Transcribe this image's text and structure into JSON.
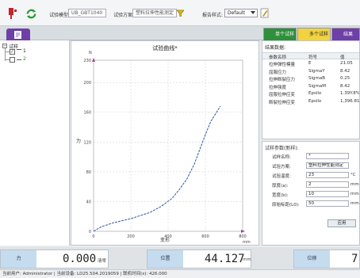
{
  "toolbar": {
    "model_label": "试验模型:",
    "model_value": "UB_GBT1040",
    "scheme_label": "试验方案:",
    "scheme_value": "塑料拉伸性能测定",
    "report_label": "报告样式:",
    "report_value": "Default"
  },
  "tabs": {
    "left_icon": "doc-icon",
    "right": [
      "单个试样",
      "多个试样",
      "结果"
    ]
  },
  "tree": {
    "root": "试样",
    "items": [
      "1",
      "2"
    ]
  },
  "chart_data": {
    "type": "line",
    "title": "试验曲线*",
    "xlabel": "变形",
    "ylabel": "力",
    "y_unit": "N",
    "x_unit": "mm",
    "xlim": [
      0,
      800
    ],
    "ylim": [
      0,
      230
    ],
    "x_ticks": [
      "0",
      "200",
      "400",
      "600",
      "800"
    ],
    "y_ticks": [
      "0",
      "40",
      "80",
      "120",
      "160",
      "200",
      "230"
    ],
    "series": [
      {
        "x": [
          0,
          40,
          100,
          200,
          300,
          360,
          420,
          460,
          500,
          540,
          570,
          600,
          630,
          660,
          680
        ],
        "y": [
          0,
          6,
          11,
          17,
          25,
          33,
          44,
          56,
          70,
          90,
          110,
          130,
          148,
          160,
          168
        ]
      }
    ]
  },
  "results": {
    "title": "结果数据:",
    "headers": [
      "参数名称",
      "符号",
      "值"
    ],
    "rows": [
      [
        "拉伸弹性模量",
        "E",
        "21.05"
      ],
      [
        "屈服应力",
        "SigmaY",
        "8.42"
      ],
      [
        "拉伸断裂应力",
        "SigmaB",
        "0.25"
      ],
      [
        "拉伸强度",
        "SigmaM",
        "8.42"
      ],
      [
        "屈服拉伸应变",
        "Epsilo",
        "1.39Y.8%"
      ],
      [
        "断裂拉伸应变",
        "Epsilo",
        "1,396.81%"
      ]
    ]
  },
  "params": {
    "title": "试样参数(新样):",
    "rows": [
      {
        "label": "试样名称:",
        "value": "*"
      },
      {
        "label": "试验方案:",
        "value": "塑料拉伸性能测定"
      },
      {
        "label": "试验温度:",
        "value": "23"
      },
      {
        "label": "厚度(a):",
        "value": "2"
      },
      {
        "label": "宽度(b):",
        "value": "10"
      },
      {
        "label": "原始标距(L0):",
        "value": "50"
      }
    ],
    "units": [
      "",
      "",
      "°C",
      "mm",
      "mm",
      "mm"
    ],
    "apply_label": "应用"
  },
  "readouts": [
    {
      "label": "力",
      "value": "0.000",
      "unit": "清零"
    },
    {
      "label": "位置",
      "value": "44.127",
      "unit": "mm"
    },
    {
      "label": "位移",
      "value": "7",
      "unit": ""
    }
  ],
  "status": {
    "text": "当前用户: Administrator | 当前设备: LD25.504.2019059 | 联机时间(s): 426.000"
  },
  "colors": {
    "accent_purple": "#6f3fa8",
    "tab_green": "#2f8f3a",
    "curve_blue": "#2a5aa5",
    "readout_label_bg": "#c5dcef"
  }
}
